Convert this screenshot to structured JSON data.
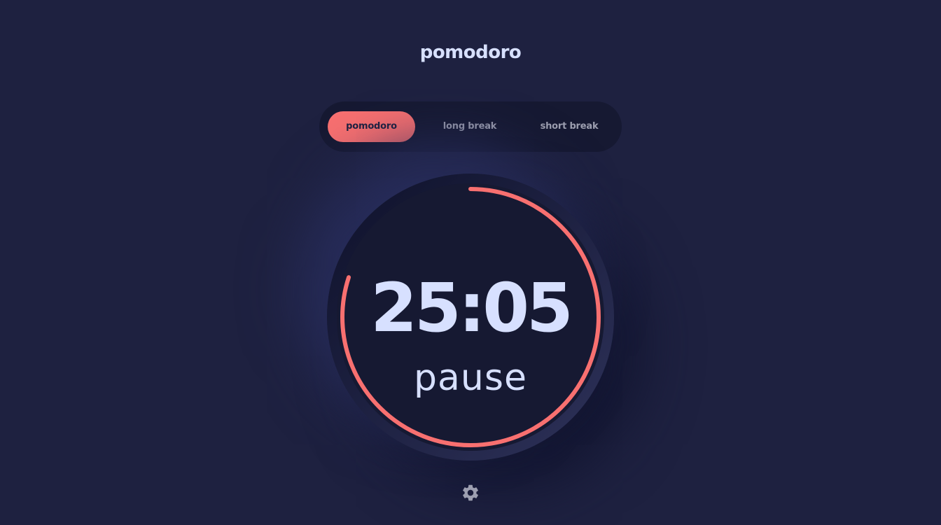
{
  "app": {
    "title": "pomodoro"
  },
  "modes": {
    "tabs": [
      {
        "label": "pomodoro",
        "active": true
      },
      {
        "label": "long break",
        "active": false
      },
      {
        "label": "short break",
        "active": false
      }
    ]
  },
  "timer": {
    "time": "25:05",
    "action": "pause",
    "progress_fraction": 0.8
  },
  "colors": {
    "background": "#1e2140",
    "accent": "#f87070",
    "text": "#d7e0ff",
    "muted": "#9d9fb0"
  },
  "icons": {
    "settings": "gear-icon"
  }
}
